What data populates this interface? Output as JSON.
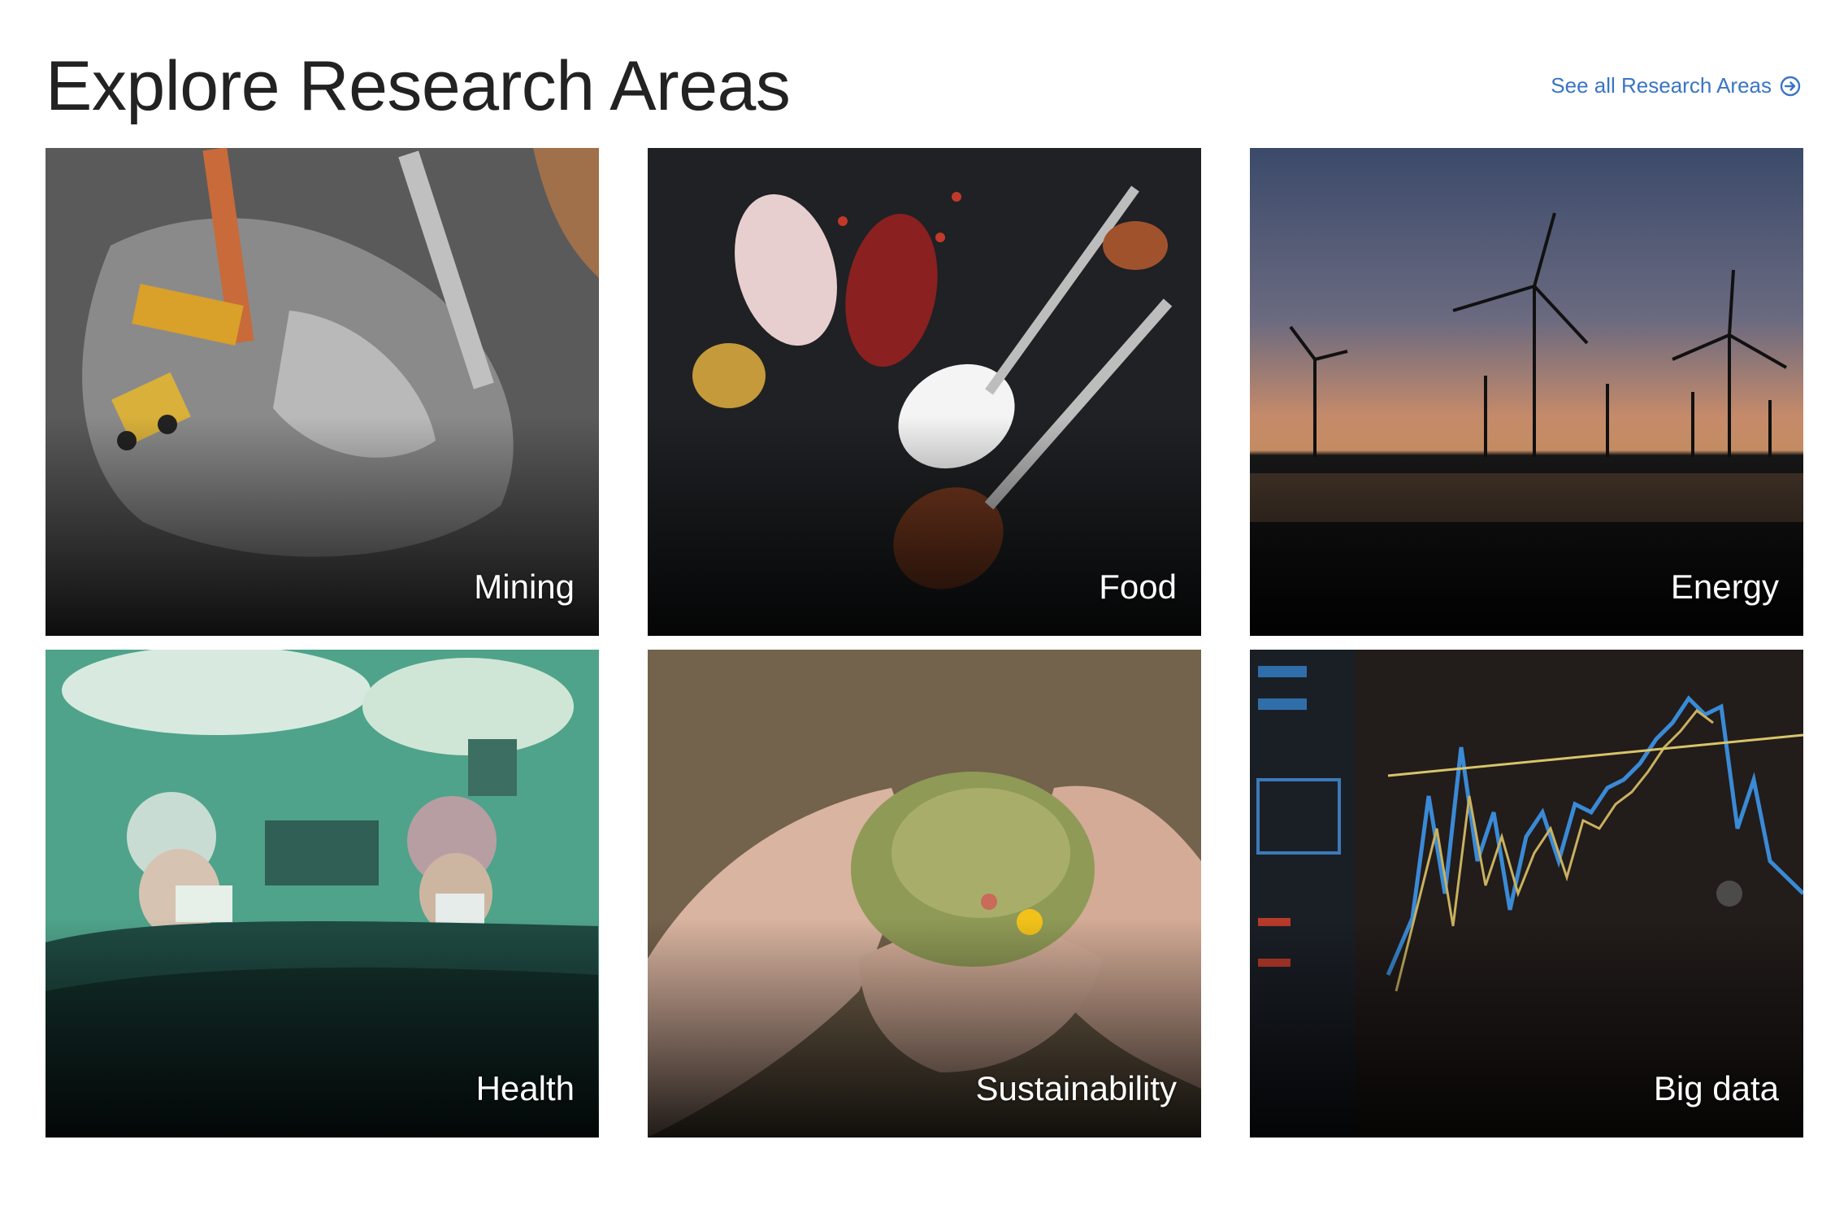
{
  "header": {
    "title": "Explore Research Areas",
    "see_all_label": "See all Research Areas",
    "see_all_icon": "arrow-circle-right-icon"
  },
  "colors": {
    "link": "#3a75c4",
    "title": "#222222",
    "label": "#ffffff"
  },
  "cards": [
    {
      "label": "Mining",
      "image": "aerial mining site with conveyor and loaders"
    },
    {
      "label": "Food",
      "image": "spoons with spices and salt"
    },
    {
      "label": "Energy",
      "image": "wind turbines at sunset over water"
    },
    {
      "label": "Health",
      "image": "surgeons in operating room"
    },
    {
      "label": "Sustainability",
      "image": "hands holding plants"
    },
    {
      "label": "Big data",
      "image": "stock chart on screen"
    }
  ]
}
